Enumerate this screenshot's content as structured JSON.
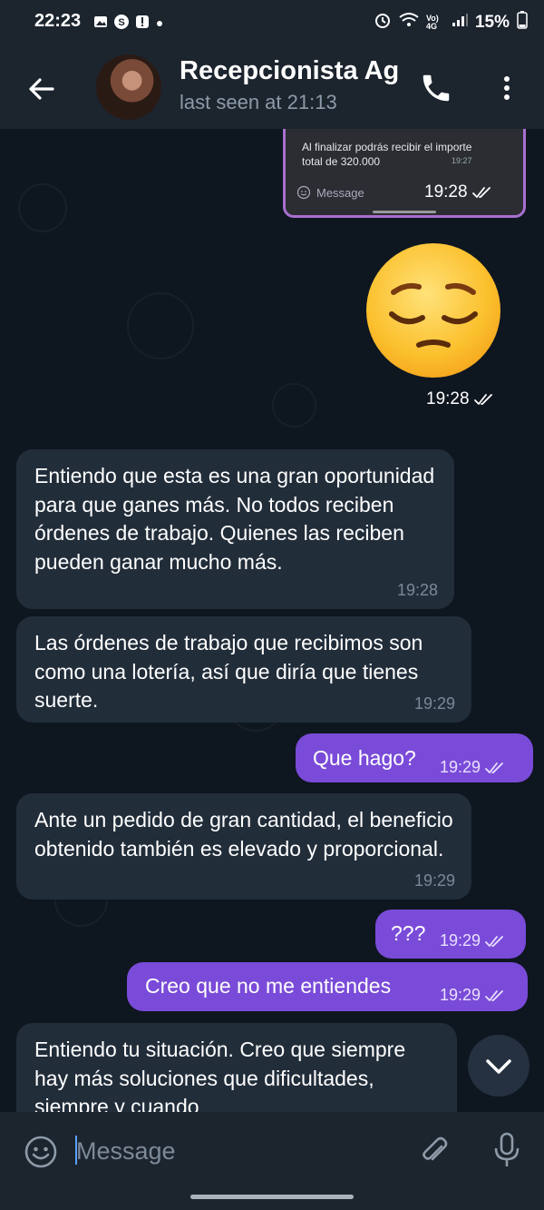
{
  "status": {
    "time": "22:23",
    "battery": "15%",
    "left_icons": [
      "gallery-icon",
      "skype-icon",
      "alert-icon",
      "dot"
    ],
    "right_icons": [
      "alarm-icon",
      "wifi-icon",
      "volte-4g-icon",
      "signal-icon",
      "battery-icon"
    ],
    "network_label": "Vo) 4G"
  },
  "header": {
    "contact_name": "Recepcionista Agu",
    "last_seen": "last seen at 21:13"
  },
  "chat": {
    "embedded": {
      "text": "Al finalizar podrás recibir el importe total de 320.000",
      "time": "19:27",
      "input_placeholder": "Message",
      "stamp": "19:28"
    },
    "emoji_message": {
      "emoji": "😔",
      "time": "19:28"
    },
    "messages": [
      {
        "dir": "in",
        "text": "Entiendo que esta es una gran oportunidad para que ganes más. No todos reciben órdenes de trabajo. Quienes las reciben pueden ganar mucho más.",
        "time": "19:28"
      },
      {
        "dir": "in",
        "text": "Las órdenes de trabajo que recibimos son como una lotería, así que diría que tienes suerte.",
        "time": "19:29"
      },
      {
        "dir": "out",
        "text": "Que hago?",
        "time": "19:29"
      },
      {
        "dir": "in",
        "text": "Ante un pedido de gran cantidad, el beneficio obtenido también es elevado y proporcional.",
        "time": "19:29"
      },
      {
        "dir": "out",
        "text": "???",
        "time": "19:29"
      },
      {
        "dir": "out",
        "text": "Creo que no me entiendes",
        "time": "19:29"
      },
      {
        "dir": "in",
        "text": "Entiendo tu situación. Creo que siempre hay más soluciones que dificultades, siempre y cuando",
        "time": ""
      }
    ]
  },
  "input": {
    "placeholder": "Message"
  },
  "colors": {
    "outgoing_bubble": "#7a4bd8",
    "incoming_bubble": "#222d3a",
    "background": "#0e1620",
    "bar": "#1c242e"
  }
}
